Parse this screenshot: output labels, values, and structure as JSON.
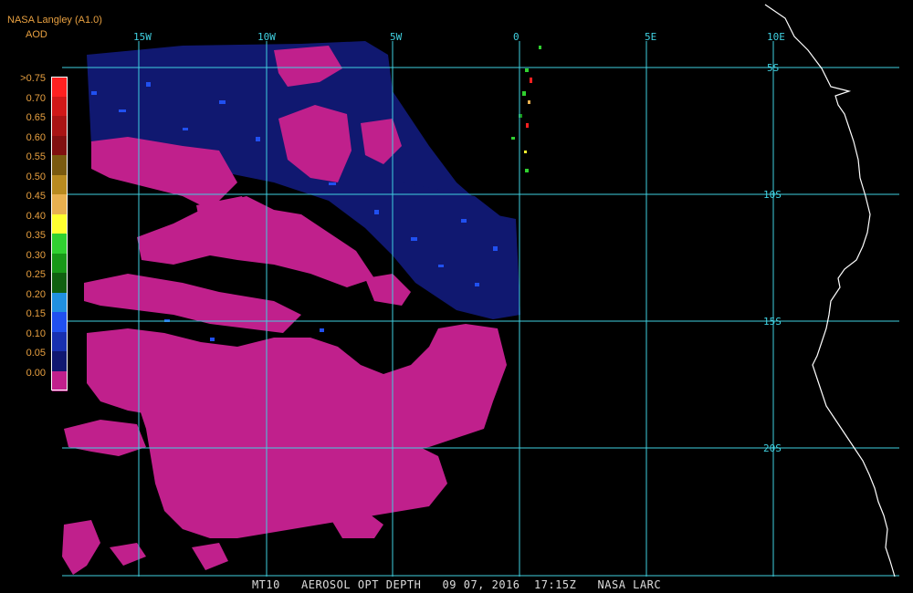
{
  "header": {
    "title": "NASA Langley (A1.0)",
    "product": "AOD"
  },
  "legend": {
    "entries": [
      {
        "label": ">0.75",
        "color": "#ff2020"
      },
      {
        "label": "0.70",
        "color": "#d01818"
      },
      {
        "label": "0.65",
        "color": "#a81414"
      },
      {
        "label": "0.60",
        "color": "#801010"
      },
      {
        "label": "0.55",
        "color": "#7a5a10"
      },
      {
        "label": "0.50",
        "color": "#b88a20"
      },
      {
        "label": "0.45",
        "color": "#e8b050"
      },
      {
        "label": "0.40",
        "color": "#ffff30"
      },
      {
        "label": "0.35",
        "color": "#30d030"
      },
      {
        "label": "0.30",
        "color": "#189818"
      },
      {
        "label": "0.25",
        "color": "#106010"
      },
      {
        "label": "0.20",
        "color": "#2090e0"
      },
      {
        "label": "0.15",
        "color": "#2050f0"
      },
      {
        "label": "0.10",
        "color": "#1830b0"
      },
      {
        "label": "0.05",
        "color": "#101870"
      },
      {
        "label": "0.00",
        "color": "#c0208c"
      }
    ]
  },
  "grid": {
    "longitude_labels": [
      "15W",
      "10W",
      "5W",
      "0",
      "5E",
      "10E"
    ],
    "latitude_labels": [
      "5S",
      "10S",
      "15S",
      "20S"
    ],
    "grid_color": "#40d0e0"
  },
  "colors": {
    "low_aod": "#c0208c",
    "background": "#000000",
    "coastline": "#ffffff"
  },
  "footer": {
    "sensor": "MT10",
    "variable": "AEROSOL OPT DEPTH",
    "date": "09 07, 2016",
    "time": "17:15Z",
    "source": "NASA LARC"
  }
}
